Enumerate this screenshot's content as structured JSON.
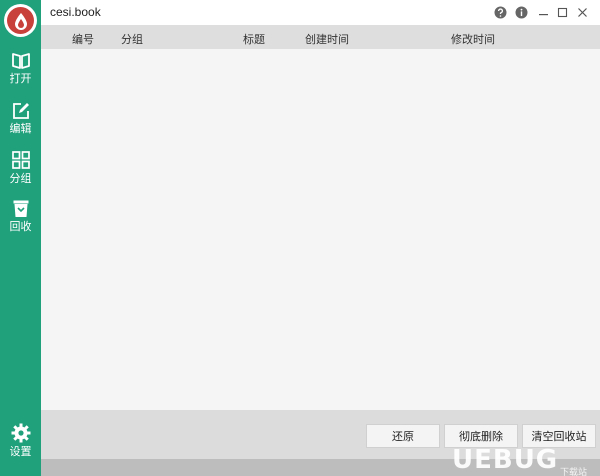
{
  "app": {
    "title": "cesi.book"
  },
  "sidebar": {
    "items": [
      {
        "label": "打开",
        "icon": "book-open-icon"
      },
      {
        "label": "编辑",
        "icon": "edit-icon"
      },
      {
        "label": "分组",
        "icon": "grid-icon"
      },
      {
        "label": "回收",
        "icon": "recycle-bin-icon"
      }
    ],
    "settings": {
      "label": "设置",
      "icon": "gear-icon"
    }
  },
  "window_controls": [
    "help-icon",
    "info-icon",
    "minimize-icon",
    "maximize-icon",
    "close-icon"
  ],
  "table": {
    "columns": [
      "编号",
      "分组",
      "标题",
      "创建时间",
      "修改时间"
    ],
    "rows": []
  },
  "footer": {
    "restore_label": "还原",
    "delete_label": "彻底删除",
    "empty_label": "清空回收站"
  },
  "watermark": {
    "text": "UEBUG",
    "sub": "下载站"
  },
  "colors": {
    "sidebar": "#21a07c",
    "logo": "#c8413a",
    "header": "#dedede",
    "body": "#f5f5f5",
    "footer": "#dcdcdc"
  }
}
